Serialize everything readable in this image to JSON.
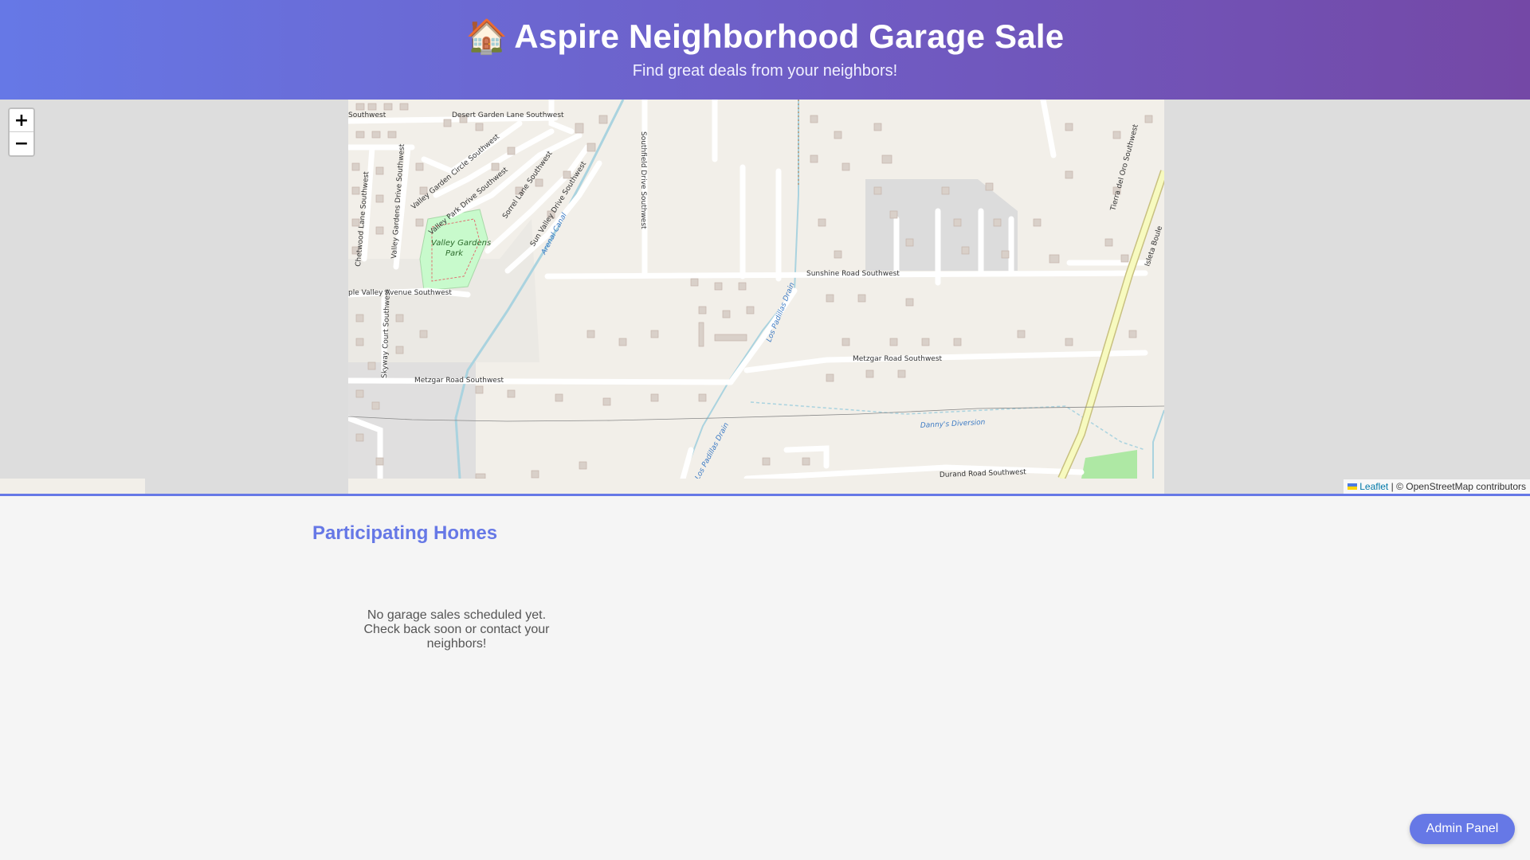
{
  "header": {
    "icon": "house-icon",
    "icon_glyph": "🏠",
    "title": "Aspire Neighborhood Garage Sale",
    "subtitle": "Find great deals from your neighbors!"
  },
  "map": {
    "zoom_in_label": "+",
    "zoom_out_label": "−",
    "attribution_leaflet": "Leaflet",
    "attribution_sep": "|",
    "attribution_osm": "© OpenStreetMap contributors",
    "streets": {
      "desert_garden": "Desert Garden Lane Southwest",
      "southwest_partial": "Southwest",
      "valley_garden_circle": "Valley Garden Circle Southwest",
      "valley_park": "Valley Park Drive Southwest",
      "sorrel": "Sorrel Lane Southwest",
      "sun_valley": "Sun Valley Drive Southwest",
      "southfield": "Southfield Drive Southwest",
      "chetwood": "Chetwood Lane Southwest",
      "valley_gardens": "Valley Gardens Drive Southwest",
      "valley_avenue": "ple Valley Avenue Southwest",
      "skyway": "Skyway Court Southwest",
      "sunshine": "Sunshine Road Southwest",
      "metzgar_west": "Metzgar Road Southwest",
      "metzgar_east": "Metzgar Road Southwest",
      "durand": "Durand Road Southwest",
      "tierra": "Tierra del Oro Southwest",
      "isleta": "Isleta Boule"
    },
    "water": {
      "arenal": "Arenal Canal",
      "los_padillas_north": "Los Padillas Drain",
      "los_padillas_south": "Los Padillas Drain",
      "dannys": "Danny's Diversion"
    },
    "park": {
      "line1": "Valley Gardens",
      "line2": "Park"
    }
  },
  "listings": {
    "title": "Participating Homes",
    "empty_message": "No garage sales scheduled yet. Check back soon or contact your neighbors!"
  },
  "admin": {
    "label": "Admin Panel"
  },
  "colors": {
    "accent": "#6678e6",
    "header_gradient_end": "#7448a6"
  }
}
